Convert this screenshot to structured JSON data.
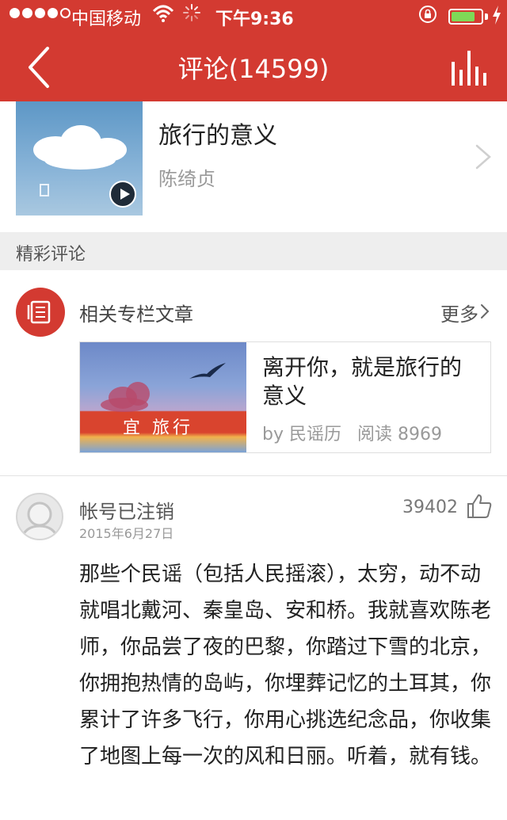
{
  "status_bar": {
    "carrier": "中国移动",
    "time": "下午9:36",
    "signal_bars": 4,
    "battery_level": 0.8,
    "icons": [
      "wifi-icon",
      "activity-icon",
      "rotation-lock-icon",
      "battery-icon",
      "charging-icon"
    ]
  },
  "header": {
    "title": "评论",
    "count": "(14599)",
    "back_icon": "chevron-left-icon",
    "right_icon": "bar-chart-icon",
    "background": "#d33a31"
  },
  "album": {
    "title": "旅行的意义",
    "artist": "陈绮贞",
    "play_icon": "play-icon"
  },
  "section": {
    "label": "精彩评论"
  },
  "related": {
    "title": "相关专栏文章",
    "more_label": "更多",
    "article": {
      "title": "离开你，就是旅行的意义",
      "author": "by 民谣历",
      "reads": "阅读 8969",
      "image_caption": "宜 旅行"
    }
  },
  "comment": {
    "username": "帐号已注销",
    "date": "2015年6月27日",
    "likes": "39402",
    "body": "那些个民谣（包括人民摇滚），太穷，动不动就唱北戴河、秦皇岛、安和桥。我就喜欢陈老师，你品尝了夜的巴黎，你踏过下雪的北京，你拥抱热情的岛屿，你埋葬记忆的土耳其，你累计了许多飞行，你用心挑选纪念品，你收集了地图上每一次的风和日丽。听着，就有钱。"
  },
  "colors": {
    "accent": "#d33a31",
    "section_bg": "#eeeeee",
    "battery": "#7ed957"
  }
}
